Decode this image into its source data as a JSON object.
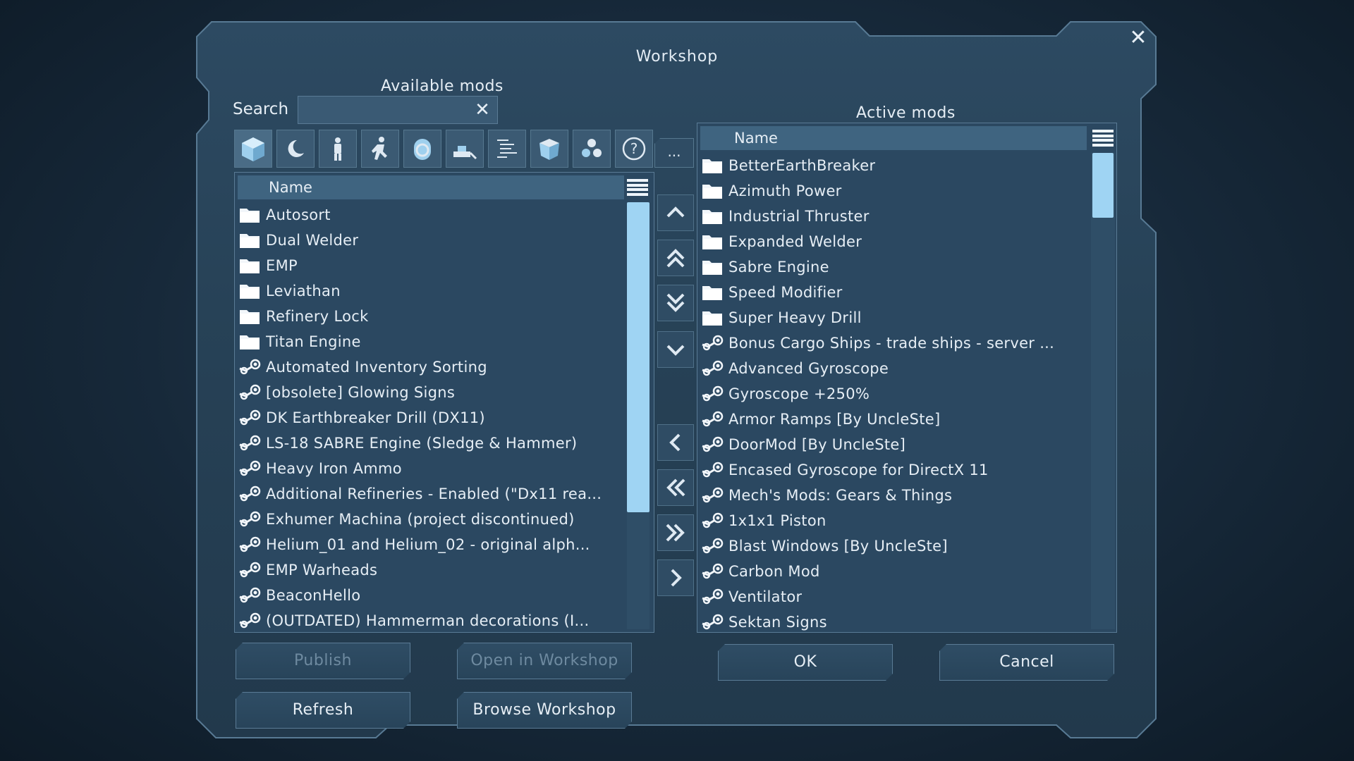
{
  "window": {
    "title": "Workshop"
  },
  "available": {
    "label": "Available mods",
    "search_label": "Search",
    "search_value": "",
    "column_name": "Name",
    "more_label": "...",
    "items": [
      {
        "icon": "folder-icon",
        "label": "Autosort"
      },
      {
        "icon": "folder-icon",
        "label": "Dual Welder"
      },
      {
        "icon": "folder-icon",
        "label": "EMP"
      },
      {
        "icon": "folder-icon",
        "label": "Leviathan"
      },
      {
        "icon": "folder-icon",
        "label": "Refinery Lock"
      },
      {
        "icon": "folder-icon",
        "label": "Titan Engine"
      },
      {
        "icon": "steam-icon",
        "label": "Automated Inventory Sorting"
      },
      {
        "icon": "steam-icon",
        "label": "[obsolete] Glowing Signs"
      },
      {
        "icon": "steam-icon",
        "label": "DK Earthbreaker Drill (DX11)"
      },
      {
        "icon": "steam-icon",
        "label": "LS-18 SABRE Engine (Sledge & Hammer)"
      },
      {
        "icon": "steam-icon",
        "label": "Heavy Iron Ammo"
      },
      {
        "icon": "steam-icon",
        "label": "Additional Refineries - Enabled (\"Dx11 rea..."
      },
      {
        "icon": "steam-icon",
        "label": "Exhumer Machina (project discontinued)"
      },
      {
        "icon": "steam-icon",
        "label": "Helium_01 and Helium_02 - original alph..."
      },
      {
        "icon": "steam-icon",
        "label": "EMP Warheads"
      },
      {
        "icon": "steam-icon",
        "label": "BeaconHello"
      },
      {
        "icon": "steam-icon",
        "label": "(OUTDATED) Hammerman decorations (I..."
      }
    ]
  },
  "active": {
    "label": "Active mods",
    "column_name": "Name",
    "items": [
      {
        "icon": "folder-icon",
        "label": "BetterEarthBreaker"
      },
      {
        "icon": "folder-icon",
        "label": "Azimuth Power"
      },
      {
        "icon": "folder-icon",
        "label": "Industrial Thruster"
      },
      {
        "icon": "folder-icon",
        "label": "Expanded Welder"
      },
      {
        "icon": "folder-icon",
        "label": "Sabre Engine"
      },
      {
        "icon": "folder-icon",
        "label": "Speed Modifier"
      },
      {
        "icon": "folder-icon",
        "label": "Super Heavy Drill"
      },
      {
        "icon": "steam-icon",
        "label": "Bonus Cargo Ships - trade ships - server ..."
      },
      {
        "icon": "steam-icon",
        "label": "Advanced Gyroscope"
      },
      {
        "icon": "steam-icon",
        "label": "Gyroscope +250%"
      },
      {
        "icon": "steam-icon",
        "label": "Armor Ramps [By UncleSte]"
      },
      {
        "icon": "steam-icon",
        "label": "DoorMod [By UncleSte]"
      },
      {
        "icon": "steam-icon",
        "label": "Encased Gyroscope for DirectX 11"
      },
      {
        "icon": "steam-icon",
        "label": "Mech's Mods: Gears & Things"
      },
      {
        "icon": "steam-icon",
        "label": "1x1x1 Piston"
      },
      {
        "icon": "steam-icon",
        "label": "Blast Windows [By UncleSte]"
      },
      {
        "icon": "steam-icon",
        "label": "Carbon Mod"
      },
      {
        "icon": "steam-icon",
        "label": "Ventilator"
      },
      {
        "icon": "steam-icon",
        "label": "Sektan Signs"
      }
    ]
  },
  "buttons": {
    "publish": "Publish",
    "open_in_workshop": "Open in Workshop",
    "refresh": "Refresh",
    "browse_workshop": "Browse Workshop",
    "ok": "OK",
    "cancel": "Cancel"
  },
  "filters": [
    "block-icon",
    "moon-icon",
    "character-icon",
    "animation-icon",
    "world-icon",
    "tool-icon",
    "script-icon",
    "container-icon",
    "production-icon",
    "help-icon"
  ]
}
